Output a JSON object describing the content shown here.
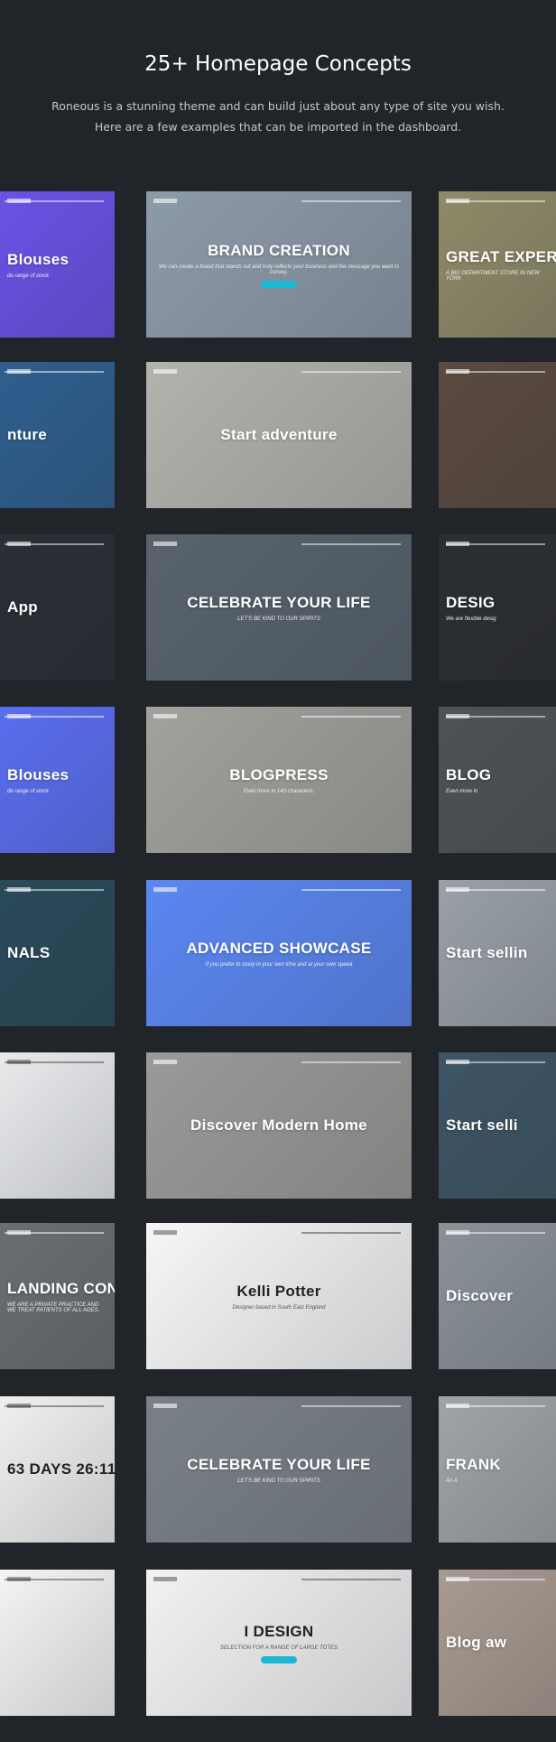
{
  "header": {
    "title": "25+ Homepage Concepts",
    "intro_line1": "Roneous is a stunning theme and can build just about any type of site you wish.",
    "intro_line2": "Here are a few examples that can be imported in the dashboard."
  },
  "colors": {
    "background": "#212429",
    "accent": "#1ab8d6"
  },
  "rows": [
    [
      {
        "title": "Blouses",
        "subtitle": "de range of stock",
        "bg": "#6a52e6"
      },
      {
        "title": "BRAND CREATION",
        "subtitle": "We can create a brand that stands out and truly reflects your business and the message you want to convey.",
        "bg": "#8d9aa8",
        "button": true
      },
      {
        "title": "GREAT EXPER",
        "subtitle": "A BIG DEPARTMENT STORE IN NEW YORK",
        "bg": "#8f8a68"
      }
    ],
    [
      {
        "title": "nture",
        "subtitle": "",
        "bg": "#2f5f8f"
      },
      {
        "title": "Start adventure",
        "subtitle": "",
        "bg": "#b3b3ad"
      },
      {
        "title": "",
        "subtitle": "",
        "bg": "#5a4a40"
      }
    ],
    [
      {
        "title": "App",
        "subtitle": "",
        "bg": "#2a2e35"
      },
      {
        "title": "CELEBRATE YOUR LIFE",
        "subtitle": "LET'S BE KIND TO OUR SPIRITS",
        "bg": "#58636d"
      },
      {
        "title": "DESIG",
        "subtitle": "We are flexible desig",
        "bg": "#2b2e33"
      }
    ],
    [
      {
        "title": "Blouses",
        "subtitle": "de range of stock",
        "bg": "#5a6ef0"
      },
      {
        "title": "BLOGPRESS",
        "subtitle": "Even more in 140 characters.",
        "bg": "#a3a19c"
      },
      {
        "title": "BLOG",
        "subtitle": "Even more in",
        "bg": "#4f5257"
      }
    ],
    [
      {
        "title": "NALS",
        "subtitle": "",
        "bg": "#2a4a5a"
      },
      {
        "title": "ADVANCED SHOWCASE",
        "subtitle": "If you prefer to study in your own time and at your own speed",
        "bg": "#5b87f2"
      },
      {
        "title": "Start sellin",
        "subtitle": "",
        "bg": "#9aa0a8"
      }
    ],
    [
      {
        "title": "",
        "subtitle": "",
        "bg": "#e8eaec",
        "dark": true
      },
      {
        "title": "Discover Modern Home",
        "subtitle": "",
        "bg": "#9a9a98"
      },
      {
        "title": "Start selli",
        "subtitle": "",
        "bg": "#3e5565"
      }
    ],
    [
      {
        "title": "LANDING CONVERSATION",
        "subtitle": "WE ARE A PRIVATE PRACTICE AND WE TREAT PATIENTS OF ALL AGES.",
        "bg": "#6a6e72"
      },
      {
        "title": "Kelli Potter",
        "subtitle": "Designer based in South East England",
        "bg": "#f6f6f6",
        "dark": true
      },
      {
        "title": "Discover",
        "subtitle": "",
        "bg": "#8a9298"
      }
    ],
    [
      {
        "title": "63 DAYS 26:11",
        "subtitle": "",
        "bg": "#f0f0f0",
        "dark": true
      },
      {
        "title": "CELEBRATE YOUR LIFE",
        "subtitle": "LET'S BE KIND TO OUR SPIRITS",
        "bg": "#7a8088"
      },
      {
        "title": "FRANK",
        "subtitle": "An A",
        "bg": "#a0a4a8"
      }
    ],
    [
      {
        "title": "",
        "subtitle": "",
        "bg": "#f4f4f4",
        "dark": true
      },
      {
        "title": "I DESIGN",
        "subtitle": "SELECTION FOR A RANGE OF LARGE TOTES",
        "bg": "#f2f2f2",
        "dark": true,
        "button": true
      },
      {
        "title": "Blog aw",
        "subtitle": "",
        "bg": "#a89a90"
      }
    ]
  ]
}
